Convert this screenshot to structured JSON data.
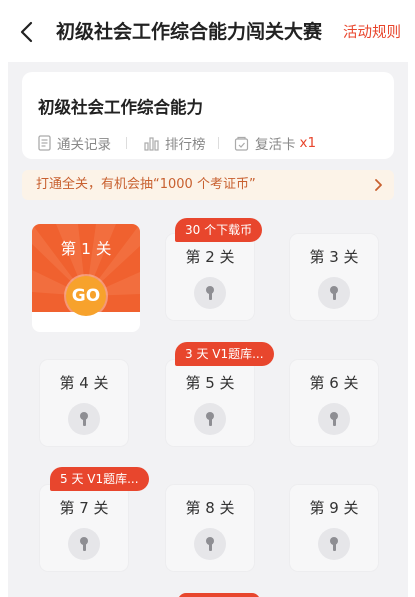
{
  "header": {
    "title": "初级社会工作综合能力闯关大赛",
    "rules_label": "活动规则"
  },
  "course": {
    "title": "初级社会工作综合能力",
    "stats": {
      "records_label": "通关记录",
      "leaderboard_label": "排行榜",
      "revive_label": "复活卡",
      "revive_count": "x1"
    }
  },
  "promo": {
    "text": "打通全关，有机会抽“1000 个考证币”"
  },
  "levels": [
    {
      "label": "第 1 关",
      "status": "active",
      "action": "GO"
    },
    {
      "label": "第 2 关",
      "status": "locked",
      "reward": "30 个下载币"
    },
    {
      "label": "第 3 关",
      "status": "locked"
    },
    {
      "label": "第 4 关",
      "status": "locked"
    },
    {
      "label": "第 5 关",
      "status": "locked",
      "reward": "3 天 V1题库..."
    },
    {
      "label": "第 6 关",
      "status": "locked"
    },
    {
      "label": "第 7 关",
      "status": "locked",
      "reward": "5 天 V1题库..."
    },
    {
      "label": "第 8 关",
      "status": "locked"
    },
    {
      "label": "第 9 关",
      "status": "locked"
    }
  ],
  "colors": {
    "accent": "#e8462d",
    "active_level": "#f0612f",
    "go_button": "#f7a22c",
    "banner_bg": "#fcf3e8",
    "page_bg": "#f2f2f4"
  }
}
